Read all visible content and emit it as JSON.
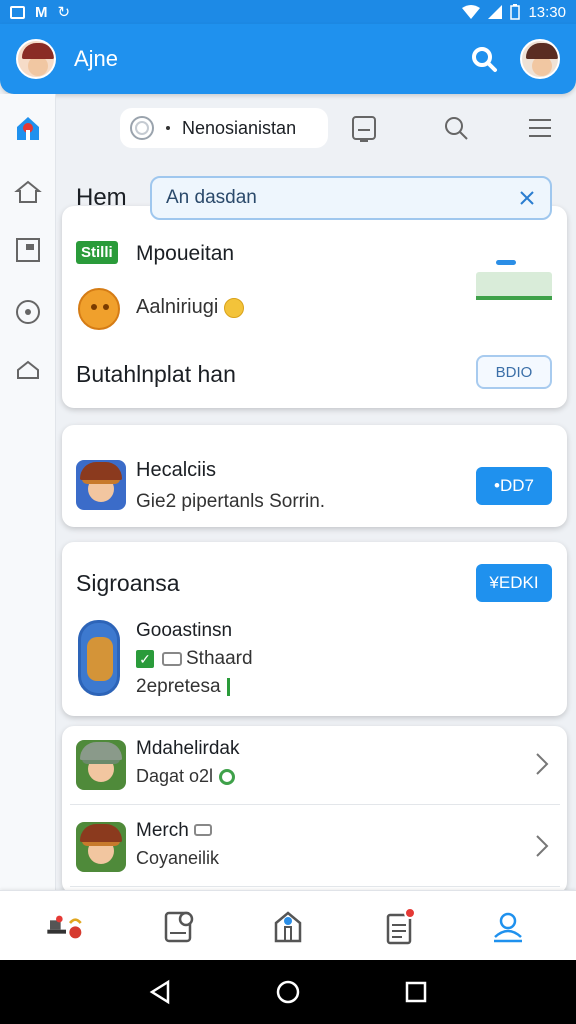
{
  "status_bar": {
    "time": "13:30"
  },
  "app_bar": {
    "title": "Ajne"
  },
  "toolbar": {
    "chip_label": "Nenosianistan"
  },
  "section": {
    "heading": "Hem",
    "input_value": "An dasdan"
  },
  "card1": {
    "badge": "Stilli",
    "title": "Mpoueitan",
    "subtitle": "Aalniriugi",
    "title2": "Butahlnplat han",
    "button": "BDIO"
  },
  "card2": {
    "title": "Hecalciis",
    "subtitle": "Gie2 pipertanls Sorrin.",
    "button": "•DD7"
  },
  "card3": {
    "title": "Sigroansa",
    "button": "¥EDKI",
    "line1": "Gooastinsn",
    "line2": "Sthaard",
    "line3": "2epretesa"
  },
  "list": [
    {
      "title": "Mdahelirdak",
      "subtitle": "Dagat o2l"
    },
    {
      "title": "Merch",
      "subtitle": "Coyaneilik"
    }
  ],
  "colors": {
    "primary": "#1f91ee",
    "green": "#2a9b3a",
    "red_badge": "#e53935"
  }
}
